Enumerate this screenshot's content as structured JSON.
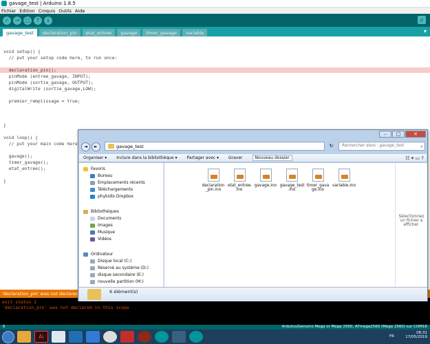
{
  "window": {
    "title": "gavage_test | Arduino 1.8.5"
  },
  "menu": [
    "Fichier",
    "Edition",
    "Croquis",
    "Outils",
    "Aide"
  ],
  "toolbar": {
    "verify": "✓",
    "upload": "→",
    "new": "▢",
    "open": "↑",
    "save": "↓",
    "serial": "ρ"
  },
  "tabs": [
    "gavage_test",
    "declaration_pin",
    "etat_entree",
    "gavage",
    "timer_gavage",
    "variable"
  ],
  "tabs_arrow": "▾",
  "code": {
    "l1": "void setup() {",
    "l2": "  // put your setup code here, to run once:",
    "l3": "  declaration_pin();",
    "l4": "  pinMode (entree_gavage, INPUT);",
    "l5": "  pinMode (sortie_gavage, OUTPUT);",
    "l6": "  digitalWrite (sortie_gavage,LOW);",
    "l7": "  premier_remplissage = true;",
    "l8": "}",
    "l9": "void loop() {",
    "l10": "  // put your main code here",
    "l11": "  gavage();",
    "l12": "  timer_gavage();",
    "l13": "  etat_entree();",
    "l14": "}"
  },
  "console": {
    "bar": "'declaration_pin' was not declared in this",
    "line1": "exit status 1",
    "line2": "'declaration_pin' was not declared in this scope"
  },
  "status": {
    "line": "6",
    "board": "Arduino/Genuino Mega or Mega 2560, ATmega2560 (Mega 2560) sur COM16"
  },
  "explorer": {
    "path": "gavage_test",
    "search_placeholder": "Rechercher dans : gavage_test",
    "commands": [
      "Organiser ▾",
      "Inclure dans la bibliothèque ▾",
      "Partager avec ▾",
      "Graver",
      "Nouveau dossier"
    ],
    "nav": {
      "favoris": "Favoris",
      "bureau": "Bureau",
      "emplacements": "Emplacements récents",
      "telechargements": "Téléchargements",
      "dropbox": "phykidis Dropbox",
      "bibliotheques": "Bibliothèques",
      "documents": "Documents",
      "images": "Images",
      "musique": "Musique",
      "videos": "Vidéos",
      "ordinateur": "Ordinateur",
      "disque_c": "Disque local (C:)",
      "reserve": "Réservé au système (D:)",
      "secondaire": "disque secondaire (E:)",
      "nouvelle": "nouvelle partition (M:)"
    },
    "files": [
      {
        "line1": "declaration",
        "line2": "_pin.ino"
      },
      {
        "line1": "etat_entree.",
        "line2": "ino"
      },
      {
        "line1": "gavage.ino",
        "line2": ""
      },
      {
        "line1": "gavage_test",
        "line2": ".ino"
      },
      {
        "line1": "timer_gava",
        "line2": "ge.ino"
      },
      {
        "line1": "variable.ino",
        "line2": ""
      }
    ],
    "preview_line1": "Sélectionnez",
    "preview_line2": "un fichier à",
    "preview_line3": "afficher.",
    "count": "6 élément(s)"
  },
  "tray": {
    "lang": "FR",
    "time": "08:31",
    "date": "17/05/2019"
  },
  "colors": {
    "arduino_teal": "#006468",
    "tab_teal": "#17a1a5",
    "error_orange": "#e97600"
  }
}
